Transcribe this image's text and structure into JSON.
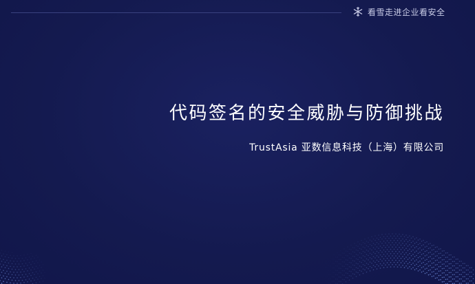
{
  "header": {
    "brand_text": "看雪走进企业看安全",
    "brand_icon": "snowflake-icon"
  },
  "slide": {
    "title": "代码签名的安全威胁与防御挑战",
    "subtitle": "TrustAsia 亚数信息科技（上海）有限公司"
  },
  "colors": {
    "background": "#141a4f",
    "rule": "#3a4280",
    "text": "#ffffff",
    "dots": "#6f8bd8"
  }
}
